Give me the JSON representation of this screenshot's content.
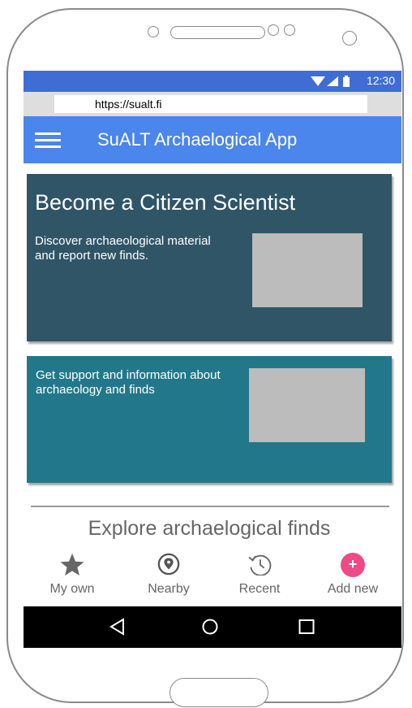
{
  "status_bar": {
    "time": "12:30",
    "icons": [
      "wifi-icon",
      "signal-icon",
      "battery-icon"
    ]
  },
  "browser": {
    "url": "https://sualt.fi"
  },
  "app_bar": {
    "title": "SuALT Archaelogical App",
    "menu_icon": "hamburger-menu-icon"
  },
  "cards": [
    {
      "title": "Become a Citizen Scientist",
      "text": "Discover archaeological material and report new finds."
    },
    {
      "text": "Get support and information about archaeology and finds"
    }
  ],
  "explore": {
    "title": "Explore archaelogical finds",
    "tabs": [
      {
        "label": "My own",
        "icon": "star-icon"
      },
      {
        "label": "Nearby",
        "icon": "location-pin-icon"
      },
      {
        "label": "Recent",
        "icon": "history-icon"
      },
      {
        "label": "Add new",
        "icon": "add-icon",
        "symbol": "+"
      }
    ]
  },
  "nav_bar": {
    "buttons": [
      "back-icon",
      "home-icon",
      "recents-icon"
    ]
  },
  "colors": {
    "status_bar": "#3f6dd4",
    "app_bar": "#4a86ec",
    "card_dark": "#2f5567",
    "card_teal": "#22788a",
    "accent_pink": "#ee4a86"
  }
}
